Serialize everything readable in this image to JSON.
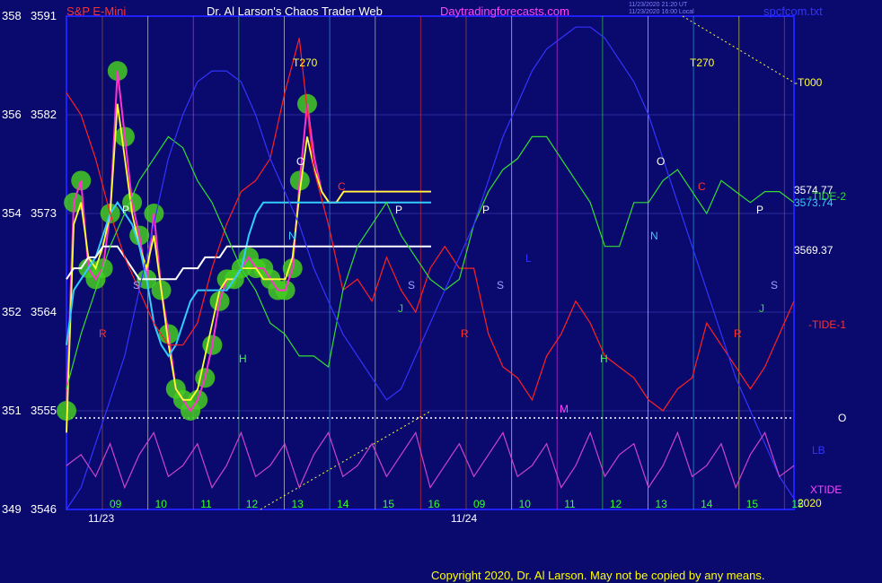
{
  "header": {
    "instrument": "S&P E-Mini",
    "title": "Dr. Al Larson's Chaos Trader Web",
    "website": "Daytradingforecasts.com",
    "stamp1": "11/23/2020 21:20 UT",
    "stamp2": "11/23/2020 16:00 Local",
    "file": "spcfcom.txt",
    "copyright": "Copyright 2020, Dr. Al Larson. May not be copied by any means."
  },
  "colors": {
    "background": "#0a0a6e",
    "frame": "#2020ff",
    "price": "#ff33cc",
    "fast_ma": "#ffff33",
    "mid_ma": "#33ccff",
    "slow_ma": "#ffffff",
    "glow": "#44cc22",
    "tide1": "#ff2020",
    "tide2": "#33dd33",
    "lb": "#3333ff",
    "xtide": "#cc44cc"
  },
  "chart_data": {
    "type": "line",
    "y_axis": {
      "left_labels": [
        "358",
        "356",
        "354",
        "352",
        "351",
        "349"
      ],
      "right_labels": [
        "3591",
        "3582",
        "3573",
        "3564",
        "3555",
        "3546"
      ],
      "ylim": [
        3546,
        3591
      ]
    },
    "x_axis": {
      "hour_labels": [
        "09",
        "10",
        "11",
        "12",
        "13",
        "14",
        "15",
        "16",
        "09",
        "10",
        "11",
        "12",
        "13",
        "14",
        "15",
        "15"
      ],
      "date_labels": [
        "11/23",
        "11/24"
      ],
      "year_label": "2020"
    },
    "right_annotations": {
      "t000": "-T000",
      "tide2_value": "3574.77",
      "tide2_label": "-TIDE-2",
      "mid_value": "3573.74",
      "level": "3569.37",
      "tide1": "-TIDE-1",
      "o_mark": "O",
      "lb": "LB",
      "xtide": "XTIDE"
    },
    "t270_label": "T270",
    "marker_letters": [
      "O",
      "C",
      "P",
      "N",
      "S",
      "J",
      "R",
      "H",
      "M",
      "L"
    ],
    "series": [
      {
        "name": "price",
        "x": [
          0,
          2,
          4,
          6,
          8,
          10,
          12,
          14,
          16,
          18,
          20,
          22,
          24,
          26,
          28,
          30,
          32,
          34,
          36,
          38,
          40,
          42,
          44,
          46,
          48,
          50,
          52,
          54,
          56,
          58,
          60,
          62,
          64,
          66,
          68,
          70,
          72,
          74,
          76,
          78,
          80,
          82,
          84,
          86,
          88,
          90,
          92,
          94,
          96,
          98,
          100
        ],
        "values": [
          3555,
          3574,
          3576,
          3568,
          3567,
          3568,
          3573,
          3586,
          3580,
          3574,
          3571,
          3567,
          3573,
          3566,
          3562,
          3557,
          3556,
          3555,
          3556,
          3558,
          3561,
          3565,
          3567,
          3567,
          3568,
          3569,
          3568,
          3568,
          3567,
          3566,
          3566,
          3568,
          3576,
          3583,
          3578,
          3575,
          3574,
          3574,
          3575,
          3575,
          3575,
          3575,
          3575,
          3575,
          3575,
          3575,
          3575,
          3575,
          3575,
          3575,
          3575
        ]
      },
      {
        "name": "fast average",
        "values": [
          3553,
          3572,
          3574,
          3569,
          3568,
          3570,
          3573,
          3583,
          3578,
          3573,
          3570,
          3568,
          3571,
          3566,
          3561,
          3557,
          3556,
          3556,
          3557,
          3560,
          3563,
          3566,
          3567,
          3567,
          3568,
          3568,
          3568,
          3567,
          3567,
          3567,
          3567,
          3569,
          3575,
          3580,
          3577,
          3575,
          3574,
          3574,
          3575,
          3575,
          3575,
          3575,
          3575,
          3575,
          3575,
          3575,
          3575,
          3575,
          3575,
          3575,
          3575
        ]
      },
      {
        "name": "medium average",
        "values": [
          3561,
          3566,
          3567,
          3568,
          3569,
          3571,
          3573,
          3574,
          3573,
          3572,
          3570,
          3567,
          3563,
          3561,
          3560,
          3561,
          3563,
          3565,
          3566,
          3566,
          3566,
          3566,
          3566,
          3567,
          3568,
          3571,
          3573,
          3574,
          3574,
          3574,
          3574,
          3574,
          3574,
          3574,
          3574,
          3574,
          3574,
          3574,
          3574,
          3574,
          3574,
          3574,
          3574,
          3574,
          3574,
          3574,
          3574,
          3574,
          3574,
          3574,
          3574
        ]
      },
      {
        "name": "slow average",
        "values": [
          3567,
          3568,
          3568,
          3569,
          3569,
          3570,
          3570,
          3570,
          3569,
          3568,
          3567,
          3567,
          3567,
          3567,
          3567,
          3567,
          3568,
          3568,
          3568,
          3569,
          3569,
          3569,
          3570,
          3570,
          3570,
          3570,
          3570,
          3570,
          3570,
          3570,
          3570,
          3570,
          3570,
          3570,
          3570,
          3570,
          3570,
          3570,
          3570,
          3570,
          3570,
          3570,
          3570,
          3570,
          3570,
          3570,
          3570,
          3570,
          3570,
          3570,
          3570
        ]
      },
      {
        "name": "TIDE-1",
        "values": [
          3584,
          3582,
          3578,
          3573,
          3569,
          3566,
          3563,
          3561,
          3561,
          3563,
          3568,
          3572,
          3575,
          3576,
          3578,
          3584,
          3589,
          3577,
          3572,
          3566,
          3567,
          3565,
          3569,
          3566,
          3564,
          3568,
          3570,
          3568,
          3568,
          3562,
          3559,
          3558,
          3556,
          3560,
          3562,
          3565,
          3563,
          3560,
          3559,
          3558,
          3556,
          3555,
          3557,
          3558,
          3563,
          3561,
          3559,
          3557,
          3559,
          3562,
          3565
        ]
      },
      {
        "name": "TIDE-2",
        "values": [
          3557,
          3562,
          3566,
          3570,
          3573,
          3576,
          3578,
          3580,
          3579,
          3576,
          3574,
          3571,
          3568,
          3566,
          3563,
          3562,
          3560,
          3560,
          3559,
          3566,
          3570,
          3572,
          3574,
          3571,
          3569,
          3567,
          3566,
          3567,
          3572,
          3575,
          3577,
          3578,
          3580,
          3580,
          3578,
          3576,
          3574,
          3570,
          3570,
          3574,
          3574,
          3576,
          3577,
          3575,
          3573,
          3576,
          3575,
          3574,
          3575,
          3575,
          3574
        ]
      },
      {
        "name": "LB",
        "values": [
          3546,
          3548,
          3552,
          3556,
          3560,
          3566,
          3572,
          3578,
          3582,
          3585,
          3586,
          3586,
          3585,
          3582,
          3578,
          3575,
          3572,
          3568,
          3565,
          3562,
          3560,
          3558,
          3556,
          3557,
          3560,
          3563,
          3566,
          3569,
          3572,
          3576,
          3580,
          3583,
          3586,
          3588,
          3589,
          3590,
          3590,
          3589,
          3587,
          3585,
          3582,
          3578,
          3574,
          3570,
          3566,
          3562,
          3558,
          3555,
          3552,
          3549,
          3547
        ]
      },
      {
        "name": "XTIDE",
        "values": [
          3550,
          3551,
          3549,
          3552,
          3548,
          3551,
          3553,
          3549,
          3550,
          3552,
          3548,
          3550,
          3553,
          3549,
          3550,
          3552,
          3548,
          3551,
          3553,
          3549,
          3550,
          3552,
          3549,
          3551,
          3553,
          3548,
          3550,
          3552,
          3549,
          3551,
          3553,
          3549,
          3550,
          3552,
          3548,
          3550,
          3553,
          3549,
          3551,
          3552,
          3548,
          3550,
          3553,
          3549,
          3550,
          3552,
          3548,
          3551,
          3553,
          3549,
          3550
        ]
      }
    ]
  }
}
